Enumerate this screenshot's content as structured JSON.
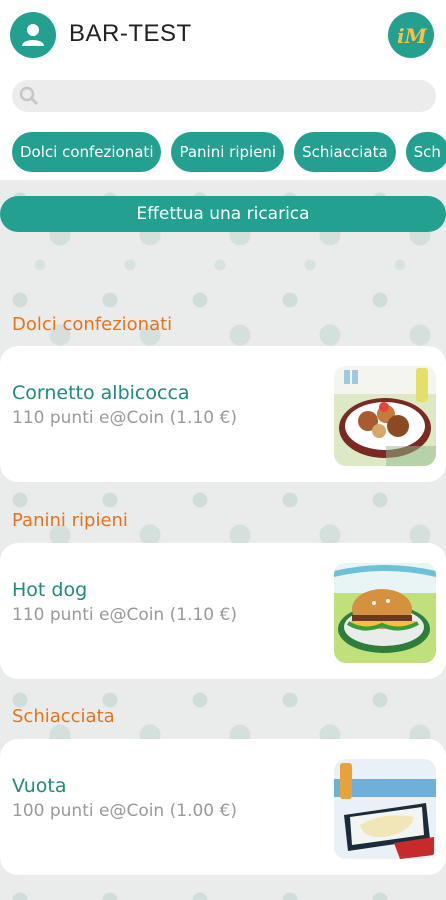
{
  "header": {
    "title": "BAR-TEST",
    "logo_text": "iM",
    "search_placeholder": ""
  },
  "categories": [
    "Dolci confezionati",
    "Panini ripieni",
    "Schiacciata",
    "Sch"
  ],
  "recharge_label": "Effettua una ricarica",
  "sections": [
    {
      "title": "Dolci confezionati",
      "item": {
        "name": "Cornetto albicocca",
        "price": "110 punti e@Coin (1.10 €)",
        "image": "pastries-plate"
      }
    },
    {
      "title": "Panini ripieni",
      "item": {
        "name": "Hot dog",
        "price": "110 punti e@Coin (1.10 €)",
        "image": "burger-plate"
      }
    },
    {
      "title": "Schiacciata",
      "item": {
        "name": "Vuota",
        "price": "100 punti e@Coin (1.00 €)",
        "image": "flatbread-plate"
      }
    }
  ],
  "colors": {
    "accent": "#23a090",
    "section_title": "#e6731e",
    "item_name": "#1f8a7d",
    "price": "#9a9a9a"
  }
}
